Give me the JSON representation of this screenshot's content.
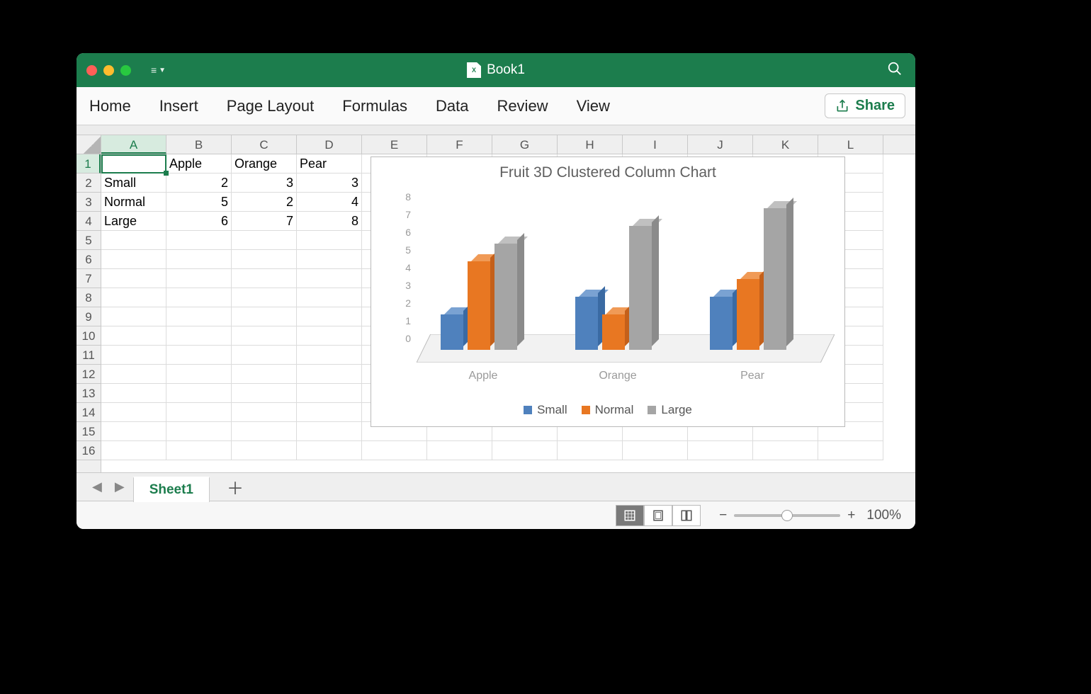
{
  "window": {
    "title": "Book1"
  },
  "ribbon": {
    "tabs": [
      "Home",
      "Insert",
      "Page Layout",
      "Formulas",
      "Data",
      "Review",
      "View"
    ],
    "share_label": "Share"
  },
  "grid": {
    "columns": [
      "A",
      "B",
      "C",
      "D",
      "E",
      "F",
      "G",
      "H",
      "I",
      "J",
      "K",
      "L"
    ],
    "row_count": 16,
    "active_cell": "A1",
    "data": {
      "headers": [
        "",
        "Apple",
        "Orange",
        "Pear"
      ],
      "rows": [
        {
          "label": "Small",
          "values": [
            2,
            3,
            3
          ]
        },
        {
          "label": "Normal",
          "values": [
            5,
            2,
            4
          ]
        },
        {
          "label": "Large",
          "values": [
            6,
            7,
            8
          ]
        }
      ]
    }
  },
  "chart_data": {
    "type": "bar",
    "title": "Fruit 3D Clustered Column Chart",
    "categories": [
      "Apple",
      "Orange",
      "Pear"
    ],
    "series": [
      {
        "name": "Small",
        "values": [
          2,
          3,
          3
        ],
        "color": "#4f81bd"
      },
      {
        "name": "Normal",
        "values": [
          5,
          2,
          4
        ],
        "color": "#e87722"
      },
      {
        "name": "Large",
        "values": [
          6,
          7,
          8
        ],
        "color": "#a5a5a5"
      }
    ],
    "ylim": [
      0,
      8
    ],
    "y_ticks": [
      0,
      1,
      2,
      3,
      4,
      5,
      6,
      7,
      8
    ],
    "xlabel": "",
    "ylabel": ""
  },
  "sheets": {
    "active": "Sheet1"
  },
  "status": {
    "zoom_label": "100%",
    "zoom_minus": "−",
    "zoom_plus": "+"
  }
}
